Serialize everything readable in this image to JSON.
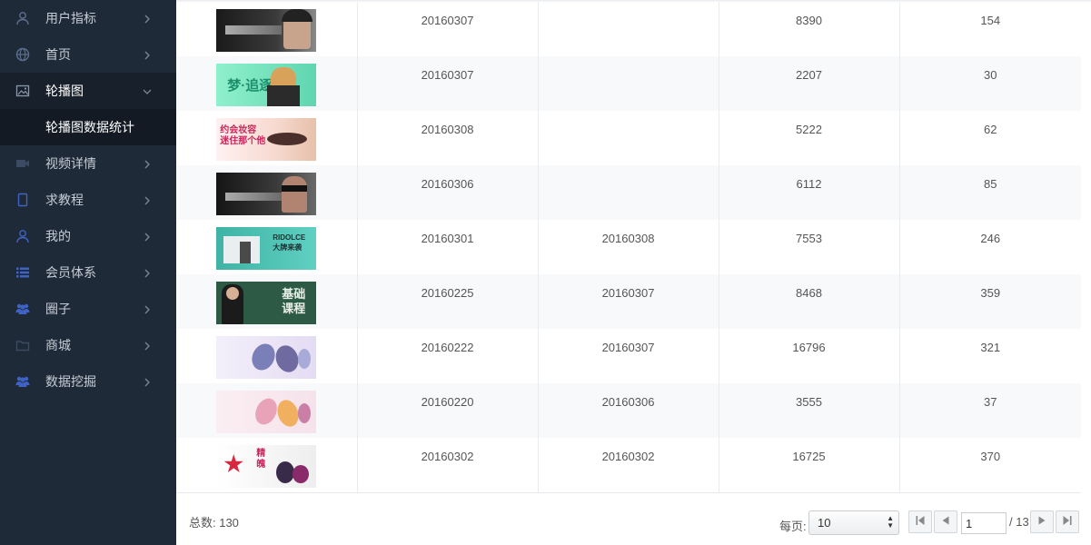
{
  "sidebar": {
    "items": [
      {
        "label": "用户指标",
        "icon": "user-icon"
      },
      {
        "label": "首页",
        "icon": "globe-icon"
      },
      {
        "label": "轮播图",
        "icon": "image-icon",
        "open": true
      },
      {
        "label": "视频详情",
        "icon": "video-icon"
      },
      {
        "label": "求教程",
        "icon": "tablet-icon"
      },
      {
        "label": "我的",
        "icon": "user-icon"
      },
      {
        "label": "会员体系",
        "icon": "list-icon"
      },
      {
        "label": "圈子",
        "icon": "users-icon"
      },
      {
        "label": "商城",
        "icon": "folder-icon"
      },
      {
        "label": "数据挖掘",
        "icon": "users-icon"
      }
    ],
    "subitem": "轮播图数据统计"
  },
  "table": {
    "rows": [
      {
        "start": "20160307",
        "end": "",
        "views": "8390",
        "clicks": "154"
      },
      {
        "start": "20160307",
        "end": "",
        "views": "2207",
        "clicks": "30"
      },
      {
        "start": "20160308",
        "end": "",
        "views": "5222",
        "clicks": "62"
      },
      {
        "start": "20160306",
        "end": "",
        "views": "6112",
        "clicks": "85"
      },
      {
        "start": "20160301",
        "end": "20160308",
        "views": "7553",
        "clicks": "246"
      },
      {
        "start": "20160225",
        "end": "20160307",
        "views": "8468",
        "clicks": "359"
      },
      {
        "start": "20160222",
        "end": "20160307",
        "views": "16796",
        "clicks": "321"
      },
      {
        "start": "20160220",
        "end": "20160306",
        "views": "3555",
        "clicks": "37"
      },
      {
        "start": "20160302",
        "end": "20160302",
        "views": "16725",
        "clicks": "370"
      }
    ],
    "thumbs": [
      {
        "text": "",
        "bg": "#1c1c1c"
      },
      {
        "text": "梦·追逐",
        "bg": "#7fe0bd"
      },
      {
        "text": "约会妆容 迷住那个他",
        "bg": "#f6e3e0"
      },
      {
        "text": "",
        "bg": "#202020"
      },
      {
        "text": "RIDOLCE 大牌来袭",
        "bg": "#4fc3b4"
      },
      {
        "text": "基础 课程",
        "bg": "#2e5b45"
      },
      {
        "text": "",
        "bg": "#e9e3f3"
      },
      {
        "text": "",
        "bg": "#f6e8ee"
      },
      {
        "text": "精魄",
        "bg": "#f4f4f4"
      }
    ]
  },
  "footer": {
    "total": "总数: 130",
    "per_page_label": "每页:",
    "per_page_value": "10",
    "current_page": "1",
    "total_pages": "/ 13"
  }
}
